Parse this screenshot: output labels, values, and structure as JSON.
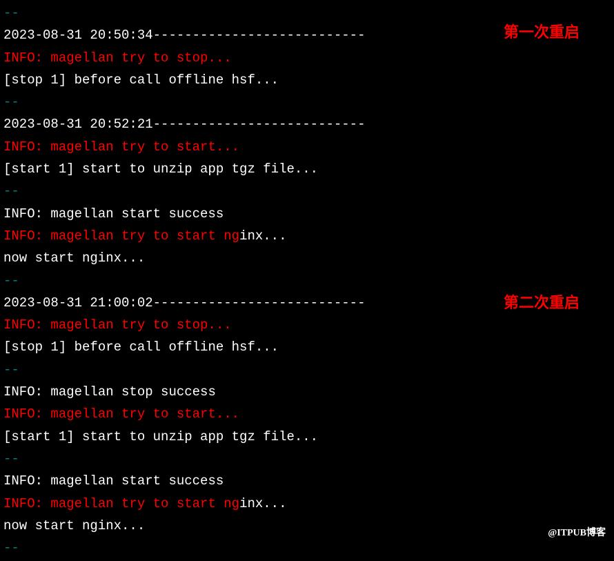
{
  "lines": [
    {
      "text": "--",
      "class": "teal"
    },
    {
      "text": "2023-08-31 20:50:34---------------------------",
      "class": "white"
    },
    {
      "text": "INFO: magellan try to stop...",
      "class": "red"
    },
    {
      "text": "[stop 1] before call offline hsf...",
      "class": "white"
    },
    {
      "text": "--",
      "class": "teal"
    },
    {
      "text": "2023-08-31 20:52:21---------------------------",
      "class": "white"
    },
    {
      "text": "INFO: magellan try to start...",
      "class": "red"
    },
    {
      "text": "[start 1] start to unzip app tgz file...",
      "class": "white"
    },
    {
      "text": "--",
      "class": "teal"
    },
    {
      "text": "INFO: magellan start success",
      "class": "white"
    },
    {
      "segments": [
        {
          "text": "INFO: magellan try to start ng",
          "class": "red"
        },
        {
          "text": "inx...",
          "class": "white"
        }
      ]
    },
    {
      "text": "now start nginx...",
      "class": "white"
    },
    {
      "text": "--",
      "class": "teal"
    },
    {
      "text": "2023-08-31 21:00:02---------------------------",
      "class": "white"
    },
    {
      "text": "INFO: magellan try to stop...",
      "class": "red"
    },
    {
      "text": "[stop 1] before call offline hsf...",
      "class": "white"
    },
    {
      "text": "--",
      "class": "teal"
    },
    {
      "text": "INFO: magellan stop success",
      "class": "white"
    },
    {
      "text": "INFO: magellan try to start...",
      "class": "red"
    },
    {
      "text": "[start 1] start to unzip app tgz file...",
      "class": "white"
    },
    {
      "text": "--",
      "class": "teal"
    },
    {
      "text": "INFO: magellan start success",
      "class": "white"
    },
    {
      "segments": [
        {
          "text": "INFO: magellan try to start ng",
          "class": "red"
        },
        {
          "text": "inx...",
          "class": "white"
        }
      ]
    },
    {
      "text": "now start nginx...",
      "class": "white"
    },
    {
      "text": "--",
      "class": "teal"
    }
  ],
  "annotations": {
    "first": "第一次重启",
    "second": "第二次重启"
  },
  "watermark": "@ITPUB博客"
}
